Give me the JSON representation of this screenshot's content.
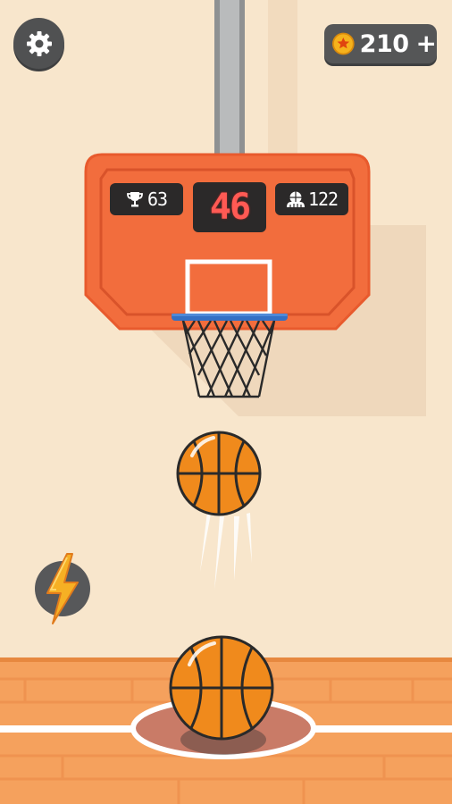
{
  "hud": {
    "settings_icon": "gear-icon",
    "coins": {
      "icon": "coin-icon",
      "value": "210",
      "add_label": "+"
    }
  },
  "scoreboard": {
    "best_icon": "trophy-icon",
    "best": "63",
    "score": "46",
    "players_icon": "players-icon",
    "players": "122"
  },
  "powerup": {
    "icon": "lightning-icon"
  },
  "colors": {
    "wall": "#f8e6cc",
    "backboard": "#f26d3d",
    "rim": "#3470c4",
    "floor": "#f5a15d",
    "score_digits": "#ff5a54",
    "panel": "#2b2929",
    "ball": "#f08a1c"
  }
}
